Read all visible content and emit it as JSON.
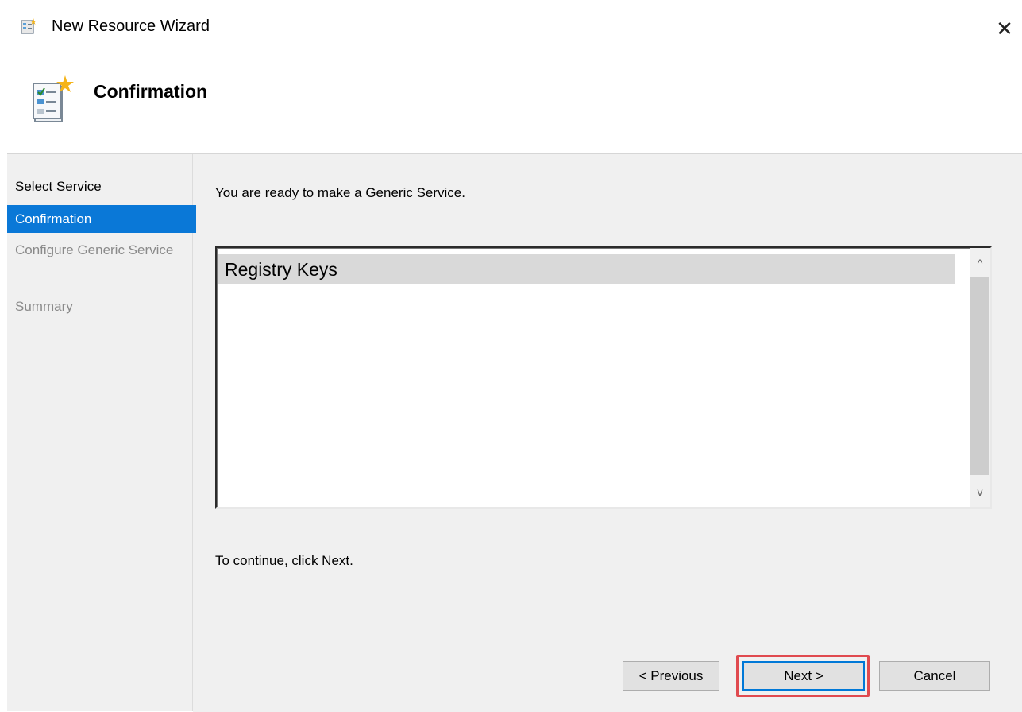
{
  "window": {
    "title": "New Resource Wizard",
    "close_label": "✕"
  },
  "header": {
    "title": "Confirmation"
  },
  "sidebar": {
    "items": [
      {
        "label": "Select Service",
        "state": "done"
      },
      {
        "label": "Confirmation",
        "state": "active"
      },
      {
        "label": "Configure Generic Service",
        "state": "future"
      },
      {
        "label": "Summary",
        "state": "future"
      }
    ]
  },
  "main": {
    "intro": "You are ready to make a Generic Service.",
    "list": {
      "items": [
        "Registry Keys"
      ],
      "scroll_up": "^",
      "scroll_down": "v"
    },
    "continue_text": "To continue, click Next."
  },
  "buttons": {
    "previous": "< Previous",
    "next": "Next >",
    "cancel": "Cancel"
  },
  "colors": {
    "active_step": "#0a78d7",
    "highlight": "#e04a4f",
    "focus_border": "#0078d7"
  },
  "icons": {
    "title": "wizard-icon",
    "header": "wizard-checklist-icon",
    "close": "close-icon"
  }
}
